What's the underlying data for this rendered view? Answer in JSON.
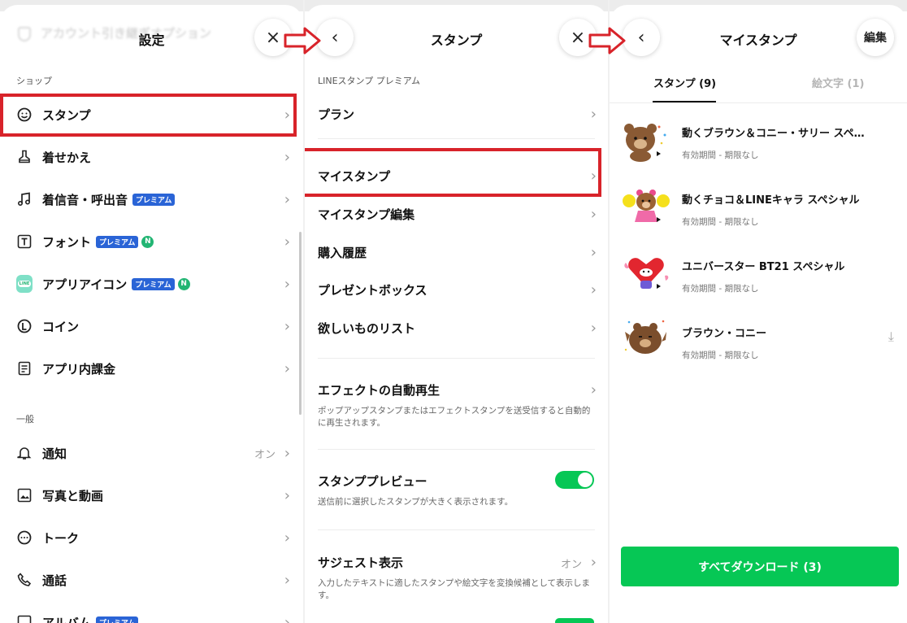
{
  "panel1": {
    "title": "設定",
    "ghost_title": "アカウント引き継ぎオプション",
    "close_icon": "×",
    "section_shop": "ショップ",
    "section_general": "一般",
    "shop_items": [
      {
        "label": "スタンプ",
        "icon": "smile-icon"
      },
      {
        "label": "着せかえ",
        "icon": "brush-icon"
      },
      {
        "label": "着信音・呼出音",
        "icon": "music-note-icon",
        "badge": "プレミアム"
      },
      {
        "label": "フォント",
        "icon": "font-icon",
        "badge": "プレミアム",
        "nbadge": "N"
      },
      {
        "label": "アプリアイコン",
        "icon": "app-icon",
        "badge": "プレミアム",
        "nbadge": "N"
      },
      {
        "label": "コイン",
        "icon": "coin-icon"
      },
      {
        "label": "アプリ内課金",
        "icon": "receipt-icon"
      }
    ],
    "general_items": [
      {
        "label": "通知",
        "icon": "bell-icon",
        "value": "オン"
      },
      {
        "label": "写真と動画",
        "icon": "photo-icon"
      },
      {
        "label": "トーク",
        "icon": "chat-icon"
      },
      {
        "label": "通話",
        "icon": "phone-icon"
      },
      {
        "label": "アルバム",
        "icon": "album-icon",
        "badge": "プレミアム"
      }
    ],
    "line_icon_text": "LINE"
  },
  "panel2": {
    "title": "スタンプ",
    "section": "LINEスタンプ プレミアム",
    "back_icon": "‹",
    "close_icon": "×",
    "items": [
      {
        "label": "プラン"
      },
      {
        "label": "マイスタンプ"
      },
      {
        "label": "マイスタンプ編集"
      },
      {
        "label": "購入履歴"
      },
      {
        "label": "プレゼントボックス"
      },
      {
        "label": "欲しいものリスト"
      }
    ],
    "effect_label": "エフェクトの自動再生",
    "effect_desc": "ポップアップスタンプまたはエフェクトスタンプを送受信すると自動的に再生されます。",
    "preview_label": "スタンププレビュー",
    "preview_desc": "送信前に選択したスタンプが大きく表示されます。",
    "preview_on": true,
    "suggest_label": "サジェスト表示",
    "suggest_value": "オン",
    "suggest_desc": "入力したテキストに適したスタンプや絵文字を変換候補として表示します。"
  },
  "panel3": {
    "title": "マイスタンプ",
    "back_icon": "‹",
    "edit_label": "編集",
    "tab_stickers": "スタンプ (9)",
    "tab_emoji": "絵文字 (1)",
    "stickers": [
      {
        "name": "動くブラウン＆コニー・サリー スペ…",
        "expiry": "有効期間 - 期限なし"
      },
      {
        "name": "動くチョコ＆LINEキャラ スペシャル",
        "expiry": "有効期間 - 期限なし"
      },
      {
        "name": "ユニバースター BT21 スペシャル",
        "expiry": "有効期間 - 期限なし"
      },
      {
        "name": "ブラウン・コニー",
        "expiry": "有効期間 - 期限なし"
      }
    ],
    "download_all": "すべてダウンロード (3)",
    "download_icon": "⤓"
  },
  "colors": {
    "line_green": "#06c755",
    "highlight_red": "#d8232a",
    "premium_blue": "#2a64d6"
  }
}
